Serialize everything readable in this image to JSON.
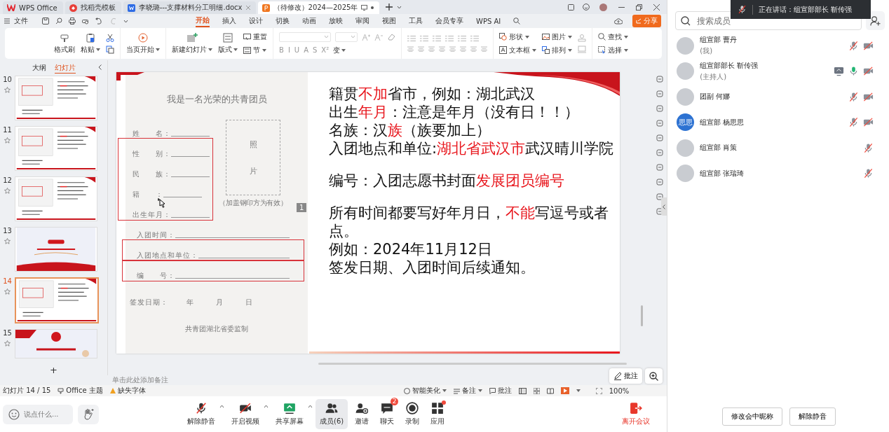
{
  "tabs": [
    {
      "label": "WPS Office",
      "kind": "home",
      "selected": false
    },
    {
      "label": "找稻壳模板",
      "kind": "template",
      "selected": false
    },
    {
      "label": "李晓璐---支撑材料分工明细.docx",
      "kind": "doc",
      "selected": false
    },
    {
      "label": "（待修改）2024—2025年",
      "kind": "ppt",
      "selected": true
    }
  ],
  "menu": {
    "file": "文件",
    "items": [
      {
        "label": "开始",
        "selected": true
      },
      {
        "label": "插入",
        "selected": false
      },
      {
        "label": "设计",
        "selected": false
      },
      {
        "label": "切换",
        "selected": false
      },
      {
        "label": "动画",
        "selected": false
      },
      {
        "label": "放映",
        "selected": false
      },
      {
        "label": "审阅",
        "selected": false
      },
      {
        "label": "视图",
        "selected": false
      },
      {
        "label": "工具",
        "selected": false
      },
      {
        "label": "会员专享",
        "selected": false
      },
      {
        "label": "WPS AI",
        "selected": false
      }
    ],
    "share": "分享"
  },
  "ribbon": {
    "format_painter": "格式刷",
    "paste": "粘贴",
    "play_from_current": "当页开始",
    "new_slide": "新建幻灯片",
    "layout": "版式",
    "reset": "重置",
    "section": "节",
    "format_buttons": [
      "B",
      "I",
      "U",
      "A",
      "S",
      "X²"
    ],
    "text_effect": "变",
    "shape": "形状",
    "picture": "图片",
    "text_box": "文本框",
    "arrange": "排列",
    "find": "查找",
    "select": "选择"
  },
  "outline": {
    "tabs": [
      {
        "label": "大纲",
        "selected": false
      },
      {
        "label": "幻灯片",
        "selected": true
      }
    ],
    "slides": [
      {
        "number": "10",
        "kind": "document",
        "selected": false
      },
      {
        "number": "11",
        "kind": "document",
        "selected": false
      },
      {
        "number": "12",
        "kind": "document",
        "selected": false
      },
      {
        "number": "13",
        "kind": "section",
        "selected": false
      },
      {
        "number": "14",
        "kind": "document",
        "selected": true
      },
      {
        "number": "15",
        "kind": "ending",
        "selected": false
      }
    ],
    "add": "+"
  },
  "slide": {
    "form": {
      "title": "我是一名光荣的共青团员",
      "upper_groups": [
        {
          "highlighted": false,
          "fields": [
            "姓　　名："
          ]
        },
        {
          "highlighted": true,
          "fields": [
            "性　　别：",
            "民　　族：",
            "籍　　：",
            "出生年月："
          ]
        }
      ],
      "photo": {
        "chars": [
          "照",
          "片"
        ],
        "note": "（加盖钢印方为有效）"
      },
      "lower_groups": [
        {
          "highlighted": false,
          "fields": [
            "入团时间："
          ]
        },
        {
          "highlighted": true,
          "fields": [
            "入团地点和单位："
          ]
        },
        {
          "highlighted": true,
          "fields": [
            "编　　号："
          ]
        }
      ],
      "issue_date": {
        "label": "签发日期：",
        "parts": [
          "年",
          "月",
          "日"
        ]
      },
      "footer": "共青团湖北省委监制"
    },
    "page_tag": "1",
    "paragraphs": [
      [
        [
          {
            "text": "籍贯",
            "highlight": false
          },
          {
            "text": "不加",
            "highlight": true
          },
          {
            "text": "省市，例如：湖北武汉",
            "highlight": false
          }
        ],
        [
          {
            "text": "出生",
            "highlight": false
          },
          {
            "text": "年月",
            "highlight": true
          },
          {
            "text": "：注意是年月（没有日！！）",
            "highlight": false
          }
        ],
        [
          {
            "text": "名族：汉",
            "highlight": false
          },
          {
            "text": "族",
            "highlight": true
          },
          {
            "text": "（族要加上）",
            "highlight": false
          }
        ],
        [
          {
            "text": "入团地点和单位:",
            "highlight": false
          },
          {
            "text": "湖北省武汉市",
            "highlight": true
          },
          {
            "text": "武汉晴川学院",
            "highlight": false
          }
        ]
      ],
      [
        [
          {
            "text": "编号：入团志愿书封面",
            "highlight": false
          },
          {
            "text": "发展团员编号",
            "highlight": true
          }
        ]
      ],
      [
        [
          {
            "text": "所有时间都要写好年月日，",
            "highlight": false
          },
          {
            "text": "不能",
            "highlight": true
          },
          {
            "text": "写逗号或者点。",
            "highlight": false
          }
        ],
        [
          {
            "text": "例如：2024年11月12日",
            "highlight": false
          }
        ],
        [
          {
            "text": "签发日期、入团时间后续通知。",
            "highlight": false
          }
        ]
      ]
    ]
  },
  "notes_placeholder": "单击此处添加备注",
  "annotate_button": "批注",
  "status": {
    "slide_count": "幻灯片 14 / 15",
    "theme": "Office 主题",
    "missing_fonts": "缺失字体",
    "beautify": "智能美化",
    "notes": "备注",
    "comments": "批注",
    "zoom": "100%"
  },
  "meeting_toolbar": {
    "chat_placeholder": "说点什么...",
    "buttons": [
      {
        "kind": "mic",
        "label": "解除静音",
        "caret": true,
        "selected": false
      },
      {
        "kind": "video",
        "label": "开启视频",
        "caret": true,
        "selected": false
      },
      {
        "kind": "share",
        "label": "共享屏幕",
        "caret": true,
        "selected": false
      },
      {
        "kind": "members",
        "label": "成员(6)",
        "caret": false,
        "selected": true
      },
      {
        "kind": "invite",
        "label": "邀请",
        "caret": false,
        "selected": false
      },
      {
        "kind": "chat",
        "label": "聊天",
        "caret": false,
        "selected": false,
        "badge": "2"
      },
      {
        "kind": "record",
        "label": "录制",
        "caret": false,
        "selected": false
      },
      {
        "kind": "apps",
        "label": "应用",
        "caret": false,
        "selected": false,
        "notify": true
      }
    ],
    "leave": "离开会议"
  },
  "members_panel": {
    "speaking": {
      "label": "正在讲话：",
      "speaker": "组宣部部长 靳传强"
    },
    "search_placeholder": "搜索成员",
    "members": [
      {
        "name": "组宣部 曹丹",
        "note": "(我)",
        "mic_on": false,
        "video_off": true,
        "sharing": false
      },
      {
        "name": "组宣部部长 靳传强",
        "note": "(主持人)",
        "mic_on": true,
        "video_off": true,
        "sharing": true
      },
      {
        "name": "团副 何娜",
        "mic_on": false,
        "video_off": true,
        "sharing": false
      },
      {
        "name": "组宣部 杨思思",
        "avatar_text": "思思",
        "mic_on": false,
        "video_off": true,
        "sharing": false
      },
      {
        "name": "组宣部 肖策",
        "mic_on": false,
        "video_off": false,
        "sharing": false
      },
      {
        "name": "组宣部 张瑞琦",
        "mic_on": false,
        "video_off": false,
        "sharing": false
      }
    ],
    "buttons": [
      "修改会中昵称",
      "解除静音"
    ]
  }
}
